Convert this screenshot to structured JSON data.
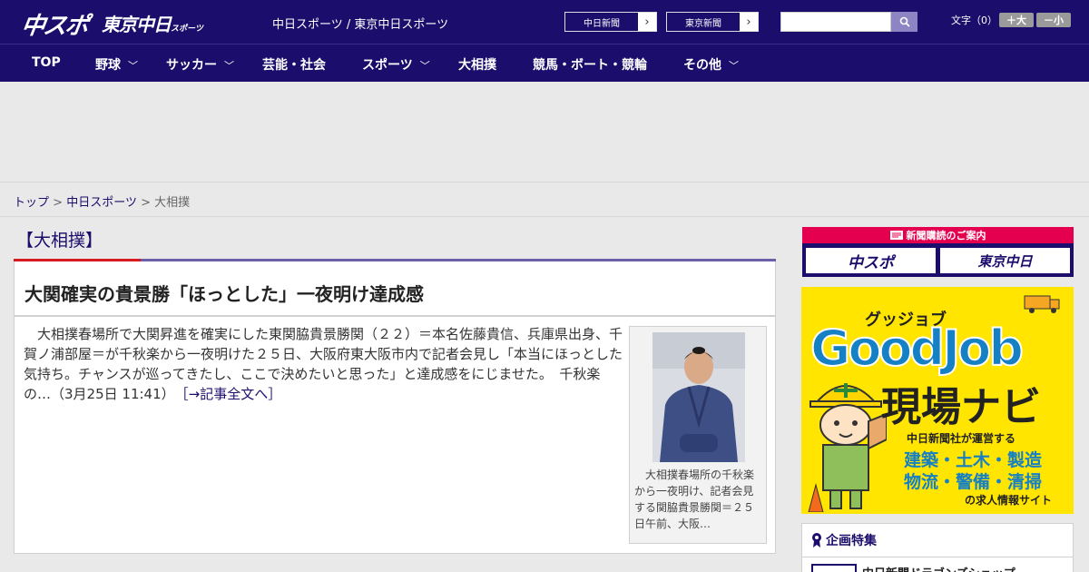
{
  "header": {
    "logo_chuspo": "中スポ",
    "logo_tokyo": "東京中日",
    "logo_tokyo_small": "スポーツ",
    "site_title": "中日スポーツ / 東京中日スポーツ",
    "paper_links": [
      "中日新聞",
      "東京新聞"
    ],
    "search": {
      "placeholder": "",
      "value": ""
    },
    "font_size_label": "文字（0）",
    "font_larger": "＋大",
    "font_smaller": "－小"
  },
  "nav": {
    "items": [
      {
        "label": "TOP",
        "dropdown": false
      },
      {
        "label": "野球",
        "dropdown": true
      },
      {
        "label": "サッカー",
        "dropdown": true
      },
      {
        "label": "芸能・社会",
        "dropdown": false
      },
      {
        "label": "スポーツ",
        "dropdown": true
      },
      {
        "label": "大相撲",
        "dropdown": false
      },
      {
        "label": "競馬・ボート・競輪",
        "dropdown": false
      },
      {
        "label": "その他",
        "dropdown": true
      }
    ]
  },
  "breadcrumb": {
    "items": [
      "トップ",
      "中日スポーツ",
      "大相撲"
    ],
    "separator": ">"
  },
  "article": {
    "category": "【大相撲】",
    "headline": "大関確実の貴景勝「ほっとした」一夜明け達成感",
    "body": "　大相撲春場所で大関昇進を確実にした東関脇貴景勝関（２２）＝本名佐藤貴信、兵庫県出身、千賀ノ浦部屋＝が千秋楽から一夜明けた２５日、大阪府東大阪市内で記者会見し「本当にほっとした気持ち。チャンスが巡ってきたし、ここで決めたいと思った」と達成感をにじませた。　千秋楽の…",
    "timestamp": "（3月25日 11:41）",
    "read_more": "［→記事全文へ］",
    "photo_caption": "大相撲春場所の千秋楽から一夜明け、記者会見する関脇貴景勝関＝２５日午前、大阪…"
  },
  "sidebar": {
    "subscribe_header": "新聞購読のご案内",
    "subscribe_logos": [
      "中スポ",
      "東京中日"
    ],
    "goodjob": {
      "ruby": "グッジョブ",
      "title": "GoodJob",
      "navi": "現場ナビ",
      "sub": "中日新聞社が運営する",
      "jobs1": "建築・土木・製造",
      "jobs2": "物流・警備・清掃",
      "site": "の求人情報サイト"
    },
    "special_title": "企画特集",
    "special_item": "中日新聞ドラゴンズショップ"
  },
  "colors": {
    "brand_navy": "#1b0d6b",
    "accent_red": "#d71920",
    "subscribe_pink": "#e5004f",
    "goodjob_yellow": "#ffe500",
    "goodjob_blue": "#1580c4"
  }
}
